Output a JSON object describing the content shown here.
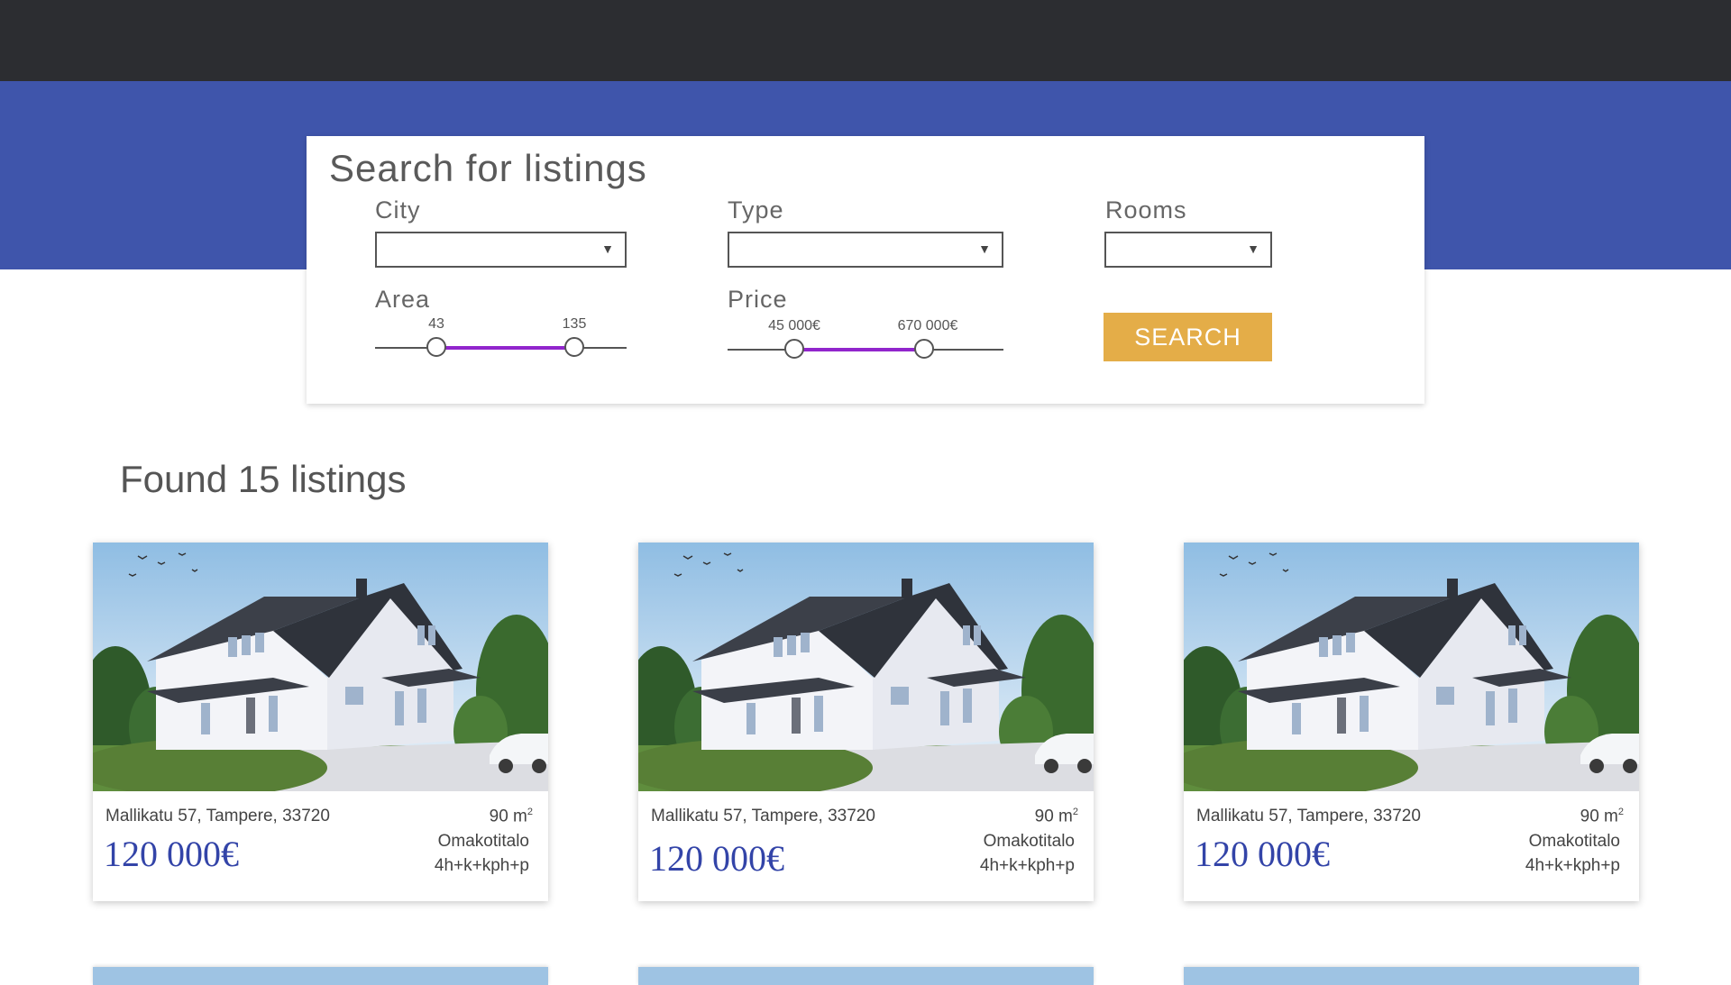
{
  "search": {
    "title": "Search for listings",
    "city": {
      "label": "City",
      "value": ""
    },
    "type": {
      "label": "Type",
      "value": ""
    },
    "rooms": {
      "label": "Rooms",
      "value": ""
    },
    "area": {
      "label": "Area",
      "min_label": "43",
      "max_label": "135",
      "min": 43,
      "max": 135
    },
    "price": {
      "label": "Price",
      "min_label": "45 000€",
      "max_label": "670 000€",
      "min": 45000,
      "max": 670000
    },
    "button_label": "SEARCH"
  },
  "results": {
    "title": "Found 15 listings",
    "listings": [
      {
        "address": "Mallikatu 57, Tampere, 33720",
        "price": "120 000€",
        "area": "90 m",
        "area_unit_sup": "2",
        "type": "Omakotitalo",
        "rooms": "4h+k+kph+p"
      },
      {
        "address": "Mallikatu 57, Tampere, 33720",
        "price": "120 000€",
        "area": "90 m",
        "area_unit_sup": "2",
        "type": "Omakotitalo",
        "rooms": "4h+k+kph+p"
      },
      {
        "address": "Mallikatu 57, Tampere, 33720",
        "price": "120 000€",
        "area": "90 m",
        "area_unit_sup": "2",
        "type": "Omakotitalo",
        "rooms": "4h+k+kph+p"
      }
    ]
  },
  "colors": {
    "topbar": "#2c2d31",
    "brand_band": "#3f55ab",
    "slider_range": "#9125cc",
    "search_button": "#e4ad48",
    "price_text": "#3344a8"
  },
  "icons": {
    "select_caret": "caret-down-icon"
  }
}
